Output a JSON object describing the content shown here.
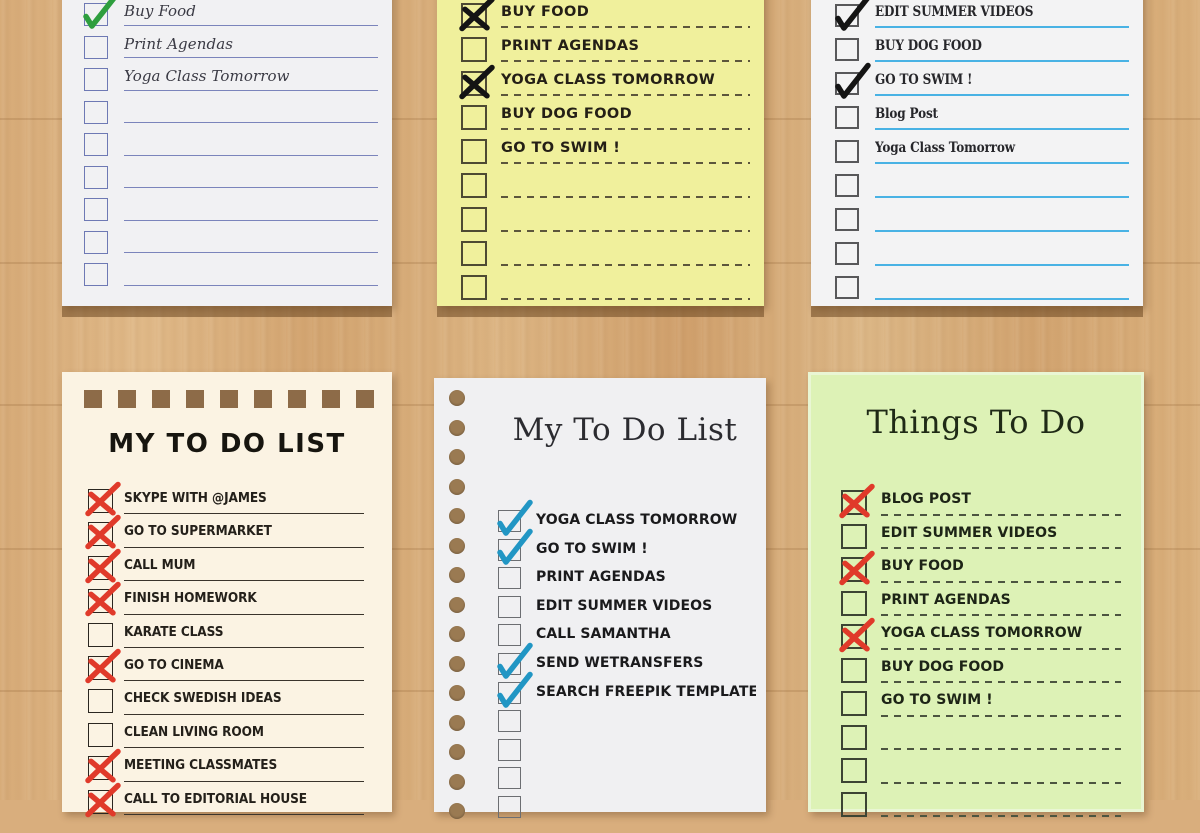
{
  "scene": {
    "description": "Six printable to-do list note templates laid on a wooden desk",
    "background_color": "#d9ae7d",
    "shadow_color": "#6e4822"
  },
  "panels": [
    {
      "id": "p1",
      "name": "top-left-violet-note",
      "paper_color": "#f1f1f3",
      "rule_color": "#7b84bb",
      "checkbox_color": "#6e79b4",
      "mark_color": "#2e9e3e",
      "mark_style": "check",
      "title": "",
      "rows": [
        {
          "label": "Buy Food",
          "checked": true
        },
        {
          "label": "Print Agendas",
          "checked": false
        },
        {
          "label": "Yoga Class Tomorrow",
          "checked": false
        },
        {
          "label": "",
          "checked": false
        },
        {
          "label": "",
          "checked": false
        },
        {
          "label": "",
          "checked": false
        },
        {
          "label": "",
          "checked": false
        },
        {
          "label": "",
          "checked": false
        },
        {
          "label": "",
          "checked": false
        }
      ]
    },
    {
      "id": "p2",
      "name": "top-middle-yellow-note",
      "paper_color": "#f0f09c",
      "rule_color": "#5c563c",
      "checkbox_color": "#4e4a33",
      "mark_color": "#141414",
      "mark_style": "cross",
      "title": "",
      "rows": [
        {
          "label": "BUY FOOD",
          "checked": true
        },
        {
          "label": "PRINT AGENDAS",
          "checked": false
        },
        {
          "label": "YOGA CLASS TOMORROW",
          "checked": true
        },
        {
          "label": "BUY DOG FOOD",
          "checked": false
        },
        {
          "label": "GO TO SWIM !",
          "checked": false
        },
        {
          "label": "",
          "checked": false
        },
        {
          "label": "",
          "checked": false
        },
        {
          "label": "",
          "checked": false
        },
        {
          "label": "",
          "checked": false
        }
      ]
    },
    {
      "id": "p3",
      "name": "top-right-blue-note",
      "paper_color": "#f3f3f4",
      "rule_color": "#49b2e4",
      "checkbox_color": "#58585a",
      "mark_color": "#141414",
      "mark_style": "check",
      "title": "",
      "rows": [
        {
          "label": "EDIT SUMMER VIDEOS",
          "checked": true
        },
        {
          "label": "BUY DOG FOOD",
          "checked": false
        },
        {
          "label": "GO TO SWIM !",
          "checked": true
        },
        {
          "label": "Blog Post",
          "checked": false
        },
        {
          "label": "Yoga Class Tomorrow",
          "checked": false
        },
        {
          "label": "",
          "checked": false
        },
        {
          "label": "",
          "checked": false
        },
        {
          "label": "",
          "checked": false
        },
        {
          "label": "",
          "checked": false
        }
      ]
    },
    {
      "id": "p4",
      "name": "bottom-left-cream-note",
      "paper_color": "#fbf3e3",
      "rule_color": "#3a342b",
      "checkbox_color": "#2a2620",
      "mark_color": "#e03a2a",
      "mark_style": "cross",
      "decoration": "nine-brown-squares",
      "decoration_color": "#8d6b48",
      "decoration_count": 9,
      "title": "MY TO DO LIST",
      "rows": [
        {
          "label": "SKYPE WITH @JAMES",
          "checked": true
        },
        {
          "label": "GO TO SUPERMARKET",
          "checked": true
        },
        {
          "label": "CALL MUM",
          "checked": true
        },
        {
          "label": "FINISH HOMEWORK",
          "checked": true
        },
        {
          "label": "KARATE CLASS",
          "checked": false
        },
        {
          "label": "GO TO CINEMA",
          "checked": true
        },
        {
          "label": "CHECK SWEDISH IDEAS",
          "checked": false
        },
        {
          "label": "CLEAN LIVING ROOM",
          "checked": false
        },
        {
          "label": "MEETING CLASSMATES",
          "checked": true
        },
        {
          "label": "CALL TO EDITORIAL HOUSE",
          "checked": true
        }
      ]
    },
    {
      "id": "p5",
      "name": "bottom-middle-spiral-note",
      "paper_color": "#f0f0f2",
      "rule_color": "",
      "checkbox_color": "#6c6e72",
      "mark_color": "#2196c4",
      "mark_style": "check",
      "decoration": "spiral-punch-holes",
      "decoration_color": "#9a7a52",
      "decoration_count": 15,
      "title": "My To Do List",
      "rows": [
        {
          "label": "YOGA CLASS TOMORROW",
          "checked": true
        },
        {
          "label": "GO TO SWIM !",
          "checked": true
        },
        {
          "label": "PRINT AGENDAS",
          "checked": false
        },
        {
          "label": "EDIT SUMMER VIDEOS",
          "checked": false
        },
        {
          "label": "CALL SAMANTHA",
          "checked": false
        },
        {
          "label": "SEND WETRANSFERS",
          "checked": true
        },
        {
          "label": "SEARCH FREEPIK TEMPLATES",
          "checked": true
        },
        {
          "label": "",
          "checked": false
        },
        {
          "label": "",
          "checked": false
        },
        {
          "label": "",
          "checked": false
        },
        {
          "label": "",
          "checked": false
        }
      ]
    },
    {
      "id": "p6",
      "name": "bottom-right-green-note",
      "paper_color": "#ddf2b6",
      "rule_color": "#4c5540",
      "checkbox_color": "#3c4433",
      "mark_color": "#e03a2a",
      "mark_style": "cross",
      "title": "Things To Do",
      "rows": [
        {
          "label": "BLOG POST",
          "checked": true
        },
        {
          "label": "EDIT SUMMER VIDEOS",
          "checked": false
        },
        {
          "label": "BUY FOOD",
          "checked": true
        },
        {
          "label": "PRINT AGENDAS",
          "checked": false
        },
        {
          "label": "YOGA CLASS TOMORROW",
          "checked": true
        },
        {
          "label": "BUY DOG FOOD",
          "checked": false
        },
        {
          "label": "GO TO SWIM !",
          "checked": false
        },
        {
          "label": "",
          "checked": false
        },
        {
          "label": "",
          "checked": false
        },
        {
          "label": "",
          "checked": false
        }
      ]
    }
  ]
}
